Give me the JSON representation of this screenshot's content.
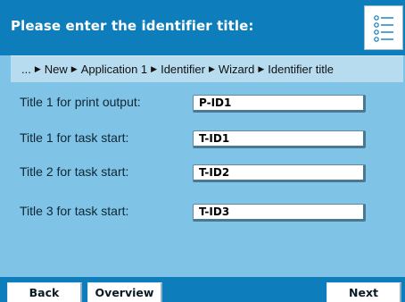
{
  "header": {
    "title": "Please enter the identifier title:",
    "menu_icon": "list-icon"
  },
  "breadcrumb": {
    "items": [
      "...",
      "New",
      "Application 1",
      "Identifier",
      "Wizard",
      "Identifier title"
    ],
    "separator_icon": "triangle-right-icon"
  },
  "form": {
    "rows": [
      {
        "label": "Title 1 for print output:",
        "value": "P-ID1"
      },
      {
        "label": "Title 1 for task start:",
        "value": "T-ID1"
      },
      {
        "label": "Title 2 for task start:",
        "value": "T-ID2"
      },
      {
        "label": "Title 3 for task start:",
        "value": "T-ID3"
      }
    ]
  },
  "footer": {
    "back_label": "Back",
    "overview_label": "Overview",
    "next_label": "Next"
  },
  "colors": {
    "header_bg": "#0d7ebb",
    "body_bg": "#7fc3e6",
    "breadcrumb_bg": "#b7dcf0"
  }
}
